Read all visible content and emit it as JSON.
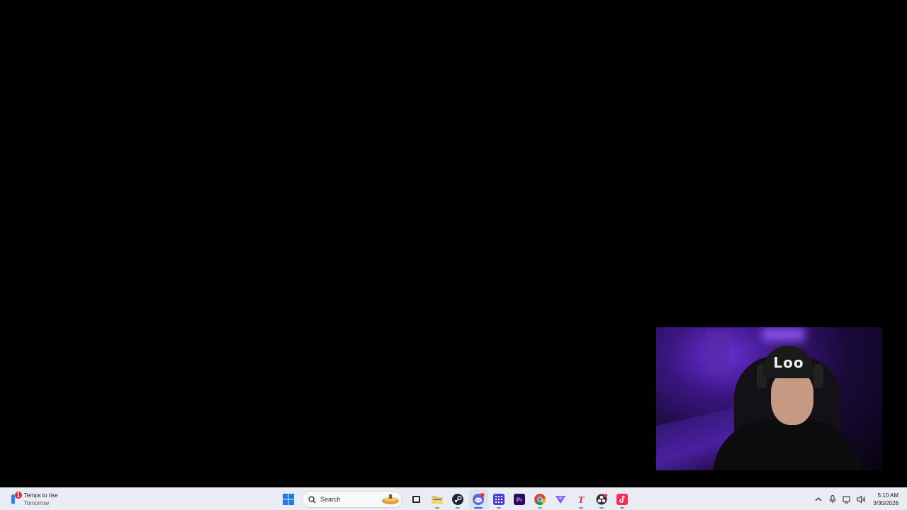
{
  "weather": {
    "title": "Temps to rise",
    "subtitle": "Tomorrow",
    "badge": "1"
  },
  "search": {
    "label": "Search"
  },
  "webcam": {
    "beanie_text": "Loo"
  },
  "taskbar_apps": [
    {
      "name": "start-button",
      "icon": "windows-logo"
    },
    {
      "name": "task-view",
      "icon": "task-view-icon"
    },
    {
      "name": "file-explorer",
      "icon": "folder-icon"
    },
    {
      "name": "steam",
      "icon": "steam-icon"
    },
    {
      "name": "discord",
      "icon": "discord-icon",
      "active": true
    },
    {
      "name": "app-grid",
      "icon": "grid-app-icon"
    },
    {
      "name": "premiere-pro",
      "icon": "premiere-icon",
      "label": "Pr"
    },
    {
      "name": "chrome",
      "icon": "chrome-icon"
    },
    {
      "name": "vpn",
      "icon": "vpn-icon"
    },
    {
      "name": "t-app",
      "icon": "t-app-icon",
      "label": "T"
    },
    {
      "name": "obs",
      "icon": "obs-icon"
    },
    {
      "name": "tiktok",
      "icon": "tiktok-icon"
    }
  ],
  "tray": {
    "time": "5:10 AM",
    "date": "3/30/2026"
  },
  "colors": {
    "taskbar_bg": "#e9ecf2",
    "accent": "#2b6fd6",
    "discord": "#5865f2",
    "premiere": "#2a0a5a",
    "tiktok": "#fe2c55"
  }
}
